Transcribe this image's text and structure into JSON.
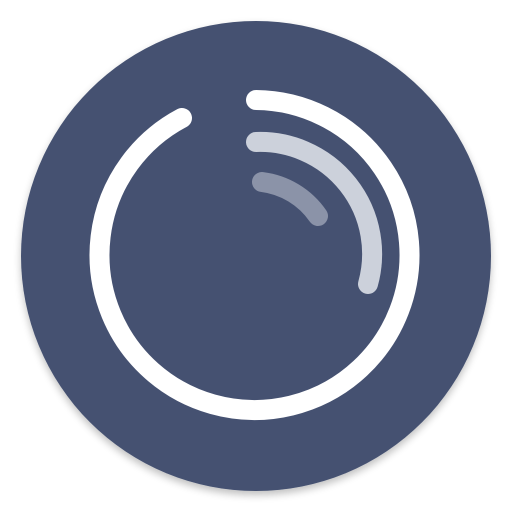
{
  "app_icon": {
    "icon_name": "loading-ring-icon",
    "colors": {
      "background": "#ffffff",
      "disc": "#445171",
      "disc_shadow": "#2a3450",
      "outer_ring": "#ffffff",
      "middle_arc": "#ccd1db",
      "inner_arc": "#8b93a8"
    }
  }
}
